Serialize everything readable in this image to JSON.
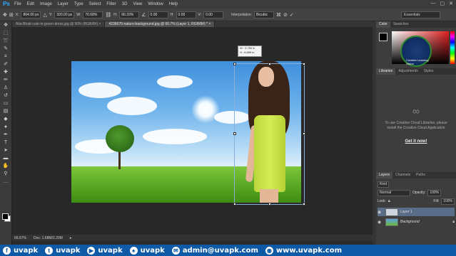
{
  "app": {
    "logo": "Ps"
  },
  "menu": [
    "File",
    "Edit",
    "Image",
    "Layer",
    "Type",
    "Select",
    "Filter",
    "3D",
    "View",
    "Window",
    "Help"
  ],
  "window_controls": [
    "—",
    "▢",
    "✕"
  ],
  "options": {
    "x_label": "X:",
    "x_value": "864.00 px",
    "y_label": "Y:",
    "y_value": "320.00 px",
    "w_label": "W:",
    "w_value": "70.68%",
    "h_label": "H:",
    "h_value": "66.33%",
    "angle_value": "0.00",
    "h_skew_label": "H:",
    "h_skew_value": "0.00",
    "v_skew_label": "V:",
    "v_skew_value": "0.00",
    "interp_label": "Interpolation:",
    "interp_value": "Bicubic",
    "workspace": "Essentials"
  },
  "tabs": [
    {
      "label": "Alia-Bhatt-cute-in-green-dress.jpg @ 50% (RGB/8#) ×",
      "active": false
    },
    {
      "label": "4236670-nature-background.jpg @ 66.7% (Layer 1, RGB/8#) * ×",
      "active": true
    }
  ],
  "transform_tip": {
    "w": "W : 3.750 in",
    "h": "H : 8.889 in"
  },
  "status": {
    "zoom": "66.67%",
    "doc": "Doc: 1.68M/2.20M"
  },
  "color_panel": {
    "tabs": [
      "Color",
      "Swatches"
    ]
  },
  "libraries_panel": {
    "tabs": [
      "Libraries",
      "Adjustments",
      "Styles"
    ],
    "message": "To use Creative Cloud Libraries, please install the Creative Cloud Application",
    "link": "Get it now!"
  },
  "logo_watermark": {
    "text": "Creative Learning Vision"
  },
  "layers_panel": {
    "tabs": [
      "Layers",
      "Channels",
      "Paths"
    ],
    "kind": "Kind",
    "blend_mode": "Normal",
    "opacity_label": "Opacity:",
    "opacity_value": "100%",
    "lock_label": "Lock:",
    "fill_label": "Fill:",
    "fill_value": "100%",
    "layers": [
      {
        "name": "Layer 1",
        "selected": true
      },
      {
        "name": "Background",
        "selected": false
      }
    ]
  },
  "social_bar": {
    "items": [
      {
        "icon": "f",
        "text": "uvapk"
      },
      {
        "icon": "t",
        "text": "uvapk"
      },
      {
        "icon": "▶",
        "text": "uvapk"
      },
      {
        "icon": "♠",
        "text": "uvapk"
      },
      {
        "icon": "✉",
        "text": "admin@uvapk.com"
      },
      {
        "icon": "◉",
        "text": "www.uvapk.com"
      }
    ]
  }
}
